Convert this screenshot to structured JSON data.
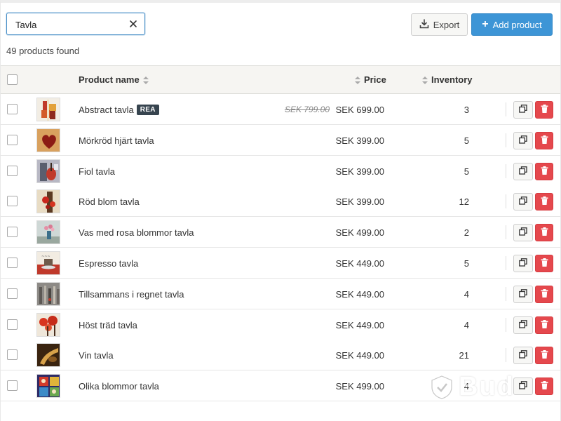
{
  "search": {
    "value": "Tavla"
  },
  "results": {
    "count_text": "49 products found"
  },
  "toolbar": {
    "export_label": "Export",
    "add_label": "Add product"
  },
  "table": {
    "columns": {
      "name": "Product name",
      "price": "Price",
      "inventory": "Inventory"
    },
    "rows": [
      {
        "name": "Abstract tavla",
        "badge": "REA",
        "old_price": "SEK 799.00",
        "price": "SEK 699.00",
        "inventory": "3",
        "thumb_icon": "abstract-painting-thumbnail"
      },
      {
        "name": "Mörkröd hjärt tavla",
        "price": "SEK 399.00",
        "inventory": "5",
        "thumb_icon": "heart-painting-thumbnail"
      },
      {
        "name": "Fiol tavla",
        "price": "SEK 399.00",
        "inventory": "5",
        "thumb_icon": "violin-painting-thumbnail"
      },
      {
        "name": "Röd blom tavla",
        "price": "SEK 399.00",
        "inventory": "12",
        "thumb_icon": "red-flower-painting-thumbnail"
      },
      {
        "name": "Vas med rosa blommor tavla",
        "price": "SEK 499.00",
        "inventory": "2",
        "thumb_icon": "vase-painting-thumbnail"
      },
      {
        "name": "Espresso tavla",
        "price": "SEK 449.00",
        "inventory": "5",
        "thumb_icon": "espresso-painting-thumbnail"
      },
      {
        "name": "Tillsammans i regnet tavla",
        "price": "SEK 449.00",
        "inventory": "4",
        "thumb_icon": "rain-painting-thumbnail"
      },
      {
        "name": "Höst träd tavla",
        "price": "SEK 449.00",
        "inventory": "4",
        "thumb_icon": "autumn-tree-painting-thumbnail"
      },
      {
        "name": "Vin tavla",
        "price": "SEK 449.00",
        "inventory": "21",
        "thumb_icon": "wine-painting-thumbnail"
      },
      {
        "name": "Olika blommor tavla",
        "price": "SEK 499.00",
        "inventory": "4",
        "thumb_icon": "flowers-painting-thumbnail"
      }
    ]
  },
  "watermark": {
    "text": "Bud"
  },
  "colors": {
    "accent": "#3d95d6",
    "danger": "#e5484d",
    "header_bg": "#f6f5f2",
    "badge_bg": "#37444f"
  }
}
